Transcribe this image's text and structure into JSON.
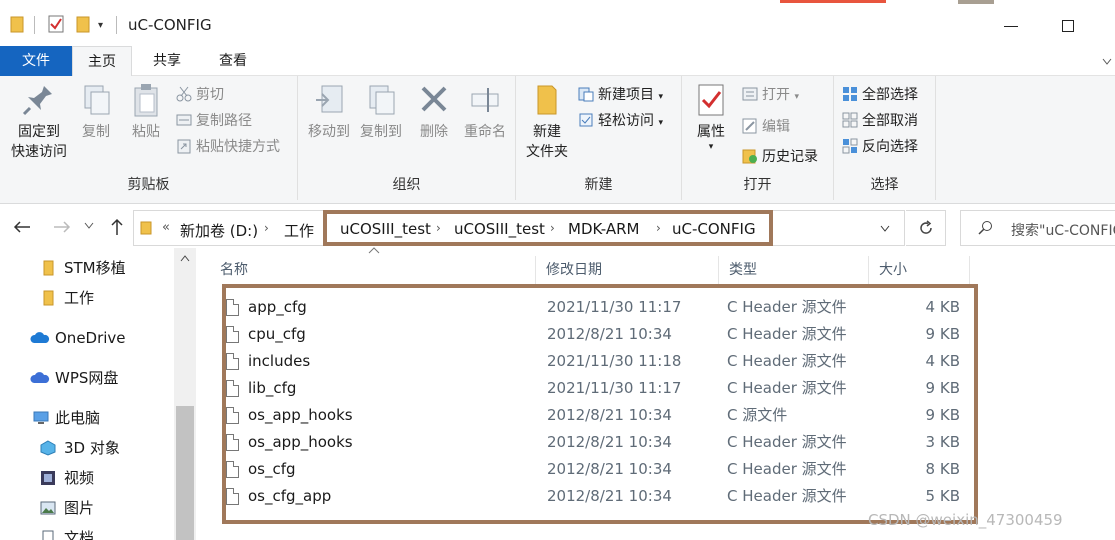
{
  "window": {
    "title": "uC-CONFIG",
    "quick_access_dropdown": "▾"
  },
  "tabs": [
    {
      "label": "文件"
    },
    {
      "label": "主页"
    },
    {
      "label": "共享"
    },
    {
      "label": "查看"
    }
  ],
  "ribbon": {
    "clipboard": {
      "pin_label_1": "固定到",
      "pin_label_2": "快速访问",
      "copy": "复制",
      "paste": "粘贴",
      "cut": "剪切",
      "copy_path": "复制路径",
      "paste_shortcut": "粘贴快捷方式",
      "group": "剪贴板"
    },
    "organize": {
      "move_to": "移动到",
      "copy_to": "复制到",
      "delete": "删除",
      "rename": "重命名",
      "group": "组织"
    },
    "new": {
      "new_folder_1": "新建",
      "new_folder_2": "文件夹",
      "new_item": "新建项目",
      "easy_access": "轻松访问",
      "group": "新建"
    },
    "open": {
      "properties": "属性",
      "open": "打开",
      "edit": "编辑",
      "history": "历史记录",
      "group": "打开"
    },
    "select": {
      "select_all": "全部选择",
      "select_none": "全部取消",
      "invert": "反向选择",
      "group": "选择"
    }
  },
  "address": {
    "prefix": "«",
    "crumbs": [
      "新加卷 (D:)",
      "工作",
      "uCOSIII_test",
      "uCOSIII_test",
      "MDK-ARM",
      "uC-CONFIG"
    ],
    "search_placeholder": "搜索\"uC-CONFIG\""
  },
  "sidebar": {
    "items": [
      {
        "label": "STM移植",
        "icon": "folder-icon"
      },
      {
        "label": "工作",
        "icon": "folder-icon"
      },
      {
        "label": "OneDrive",
        "icon": "cloud-icon"
      },
      {
        "label": "WPS网盘",
        "icon": "cloud-icon"
      },
      {
        "label": "此电脑",
        "icon": "computer-icon"
      },
      {
        "label": "3D 对象",
        "icon": "cube-icon"
      },
      {
        "label": "视频",
        "icon": "video-icon"
      },
      {
        "label": "图片",
        "icon": "picture-icon"
      },
      {
        "label": "文档",
        "icon": "document-icon"
      }
    ]
  },
  "columns": {
    "name": "名称",
    "date": "修改日期",
    "type": "类型",
    "size": "大小"
  },
  "files": [
    {
      "name": "app_cfg",
      "date": "2021/11/30 11:17",
      "type": "C Header 源文件",
      "size": "4 KB"
    },
    {
      "name": "cpu_cfg",
      "date": "2012/8/21 10:34",
      "type": "C Header 源文件",
      "size": "9 KB"
    },
    {
      "name": "includes",
      "date": "2021/11/30 11:18",
      "type": "C Header 源文件",
      "size": "4 KB"
    },
    {
      "name": "lib_cfg",
      "date": "2021/11/30 11:17",
      "type": "C Header 源文件",
      "size": "9 KB"
    },
    {
      "name": "os_app_hooks",
      "date": "2012/8/21 10:34",
      "type": "C 源文件",
      "size": "9 KB"
    },
    {
      "name": "os_app_hooks",
      "date": "2012/8/21 10:34",
      "type": "C Header 源文件",
      "size": "3 KB"
    },
    {
      "name": "os_cfg",
      "date": "2012/8/21 10:34",
      "type": "C Header 源文件",
      "size": "8 KB"
    },
    {
      "name": "os_cfg_app",
      "date": "2012/8/21 10:34",
      "type": "C Header 源文件",
      "size": "5 KB"
    }
  ],
  "watermark": "CSDN @weixin_47300459",
  "colors": {
    "accent": "#1565c0",
    "highlight_box": "#a0785a",
    "folder": "#f0c14b"
  }
}
